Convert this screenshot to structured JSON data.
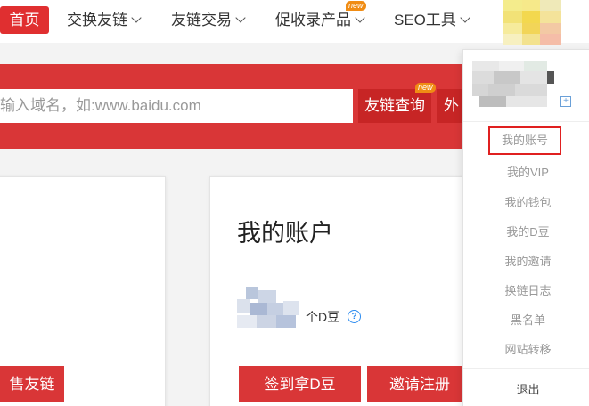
{
  "nav": {
    "home": "首页",
    "items": [
      {
        "label": "交换友链"
      },
      {
        "label": "友链交易"
      },
      {
        "label": "促收录产品",
        "badge": "new"
      },
      {
        "label": "SEO工具"
      }
    ]
  },
  "search": {
    "placeholder": "输入域名，如:www.baidu.com",
    "query_button": "友链查询",
    "query_badge": "new",
    "second_button": "外"
  },
  "left_card": {
    "button": "售友链"
  },
  "account_card": {
    "title": "我的账户",
    "dou_suffix": "个D豆",
    "help_icon": "?",
    "buttons": [
      "签到拿D豆",
      "邀请注册"
    ]
  },
  "dropdown": {
    "items": [
      "我的账号",
      "我的VIP",
      "我的钱包",
      "我的D豆",
      "我的邀请",
      "换链日志",
      "黑名单",
      "网站转移"
    ],
    "logout": "退出",
    "highlighted_index": 0,
    "plus_icon": "+"
  },
  "colors": {
    "brand_red": "#d93637",
    "nav_home_red": "#e02f30",
    "new_badge": "#f08c14",
    "help_blue": "#2d8cf0",
    "highlight_border": "#e02020"
  }
}
